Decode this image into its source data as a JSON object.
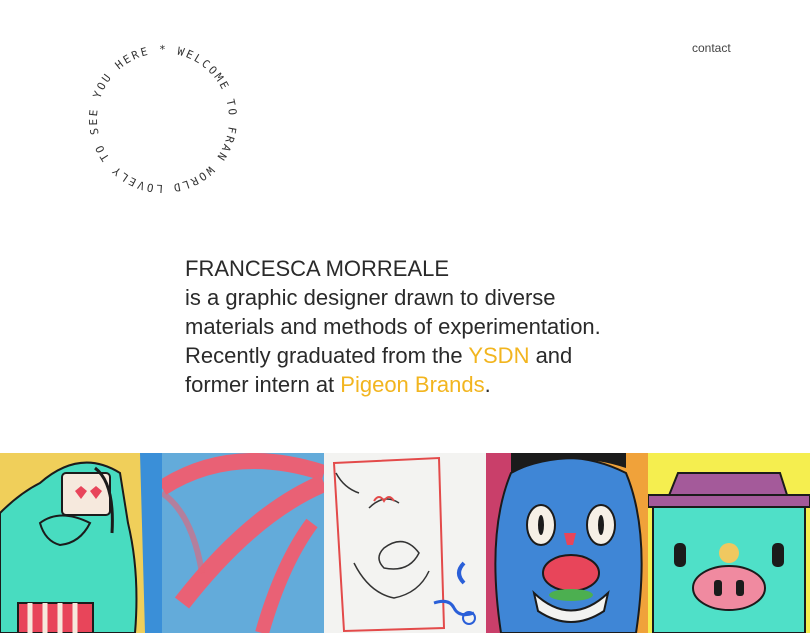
{
  "badge": {
    "text": "LOVELY TO SEE YOU HERE * WELCOME TO FRAN WORLD * "
  },
  "nav": {
    "contact": "contact"
  },
  "intro": {
    "name": "FRANCESCA MORREALE",
    "line1": "is a graphic designer drawn to diverse",
    "line2": "materials and methods of experimentation.",
    "line3_prefix": "Recently graduated from the ",
    "line3_link": "YSDN",
    "line3_suffix": " and",
    "line4_prefix": "former intern at ",
    "line4_link": "Pigeon Brands",
    "line4_suffix": "."
  },
  "colors": {
    "accent": "#f2b51f",
    "text": "#2a2a2a"
  },
  "gallery": {
    "tiles": [
      {
        "icon": "heart-eyes-character-illustration"
      },
      {
        "icon": "pink-brushstroke-on-blue-illustration"
      },
      {
        "icon": "disco-sketch-illustration"
      },
      {
        "icon": "blue-monster-eating-illustration"
      },
      {
        "icon": "pink-nose-character-illustration"
      }
    ]
  }
}
